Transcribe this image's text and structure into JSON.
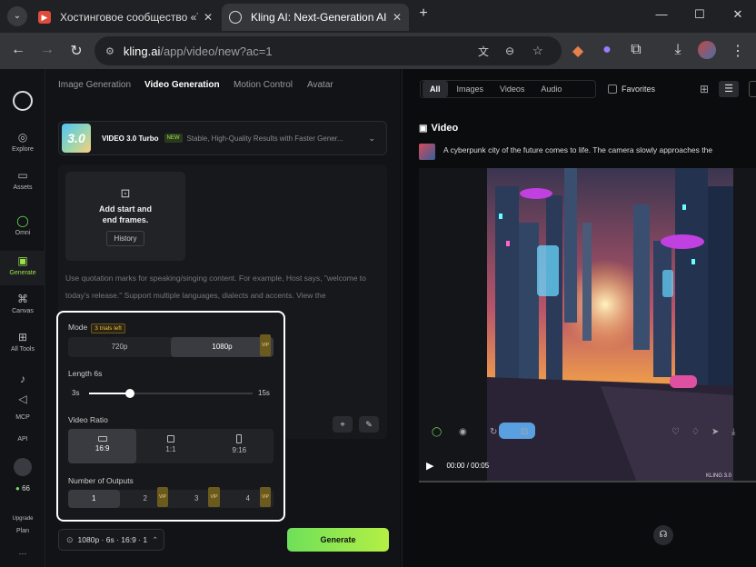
{
  "browser": {
    "tabs": [
      {
        "title": "Хостинговое сообщество «Tim",
        "favicon_color": "#e04b3a",
        "active": false
      },
      {
        "title": "Kling AI: Next-Generation AI Cr",
        "favicon_color": "#5b5b5b",
        "active": true
      }
    ],
    "url_host": "kling.ai",
    "url_path": "/app/video/new?ac=1"
  },
  "sidebar": {
    "items": [
      {
        "label": "Explore"
      },
      {
        "label": "Assets"
      },
      {
        "label": "Omni"
      },
      {
        "label": "Generate",
        "active": true
      },
      {
        "label": "Canvas"
      },
      {
        "label": "All Tools"
      },
      {
        "label": ""
      },
      {
        "label": ""
      },
      {
        "label": "MCP"
      },
      {
        "label": "API"
      }
    ],
    "credits": "66",
    "upgrade": "Upgrade",
    "plan": "Plan",
    "more": "···"
  },
  "left": {
    "tabs": [
      "Image Generation",
      "Video Generation",
      "Motion Control",
      "Avatar"
    ],
    "active_tab": 1,
    "model": {
      "logo": "3.0",
      "name": "VIDEO 3.0 Turbo",
      "badge": "NEW",
      "desc": "Stable, High-Quality Results with Faster Gener..."
    },
    "frames": {
      "line1": "Add start and",
      "line2": "end frames.",
      "history": "History"
    },
    "hint": "Use quotation marks for speaking/singing content. For example, Host says, \"welcome to today's release.\" Support multiple languages, dialects and accents. View the",
    "settings": {
      "mode_label": "Mode",
      "trials": "3 trials left",
      "modes": [
        {
          "label": "720p",
          "vip": false
        },
        {
          "label": "1080p",
          "vip": true,
          "selected": true
        }
      ],
      "length_label": "Length 6s",
      "length_min": "3s",
      "length_max": "15s",
      "length_fraction": 0.25,
      "ratio_label": "Video Ratio",
      "ratios": [
        {
          "label": "16:9",
          "selected": true
        },
        {
          "label": "1:1"
        },
        {
          "label": "9:16"
        }
      ],
      "outputs_label": "Number of Outputs",
      "outputs": [
        {
          "label": "1",
          "selected": true
        },
        {
          "label": "2",
          "vip": true
        },
        {
          "label": "3",
          "vip": true
        },
        {
          "label": "4",
          "vip": true
        }
      ],
      "vip_text": "VIP"
    },
    "summary": "1080p · 6s · 16:9 · 1",
    "generate": "Generate"
  },
  "right": {
    "filters": [
      "All",
      "Images",
      "Videos",
      "Audio"
    ],
    "favorites": "Favorites",
    "video_heading": "Video",
    "video_prompt": "A cyberpunk city of the future comes to life. The camera slowly approaches the",
    "time": "00:00 / 00:05",
    "watermark": "KLING 3.0",
    "progress": 0
  },
  "colors": {
    "accent": "#9be24a",
    "generate_start": "#6ee05a",
    "generate_end": "#b4ef45"
  }
}
